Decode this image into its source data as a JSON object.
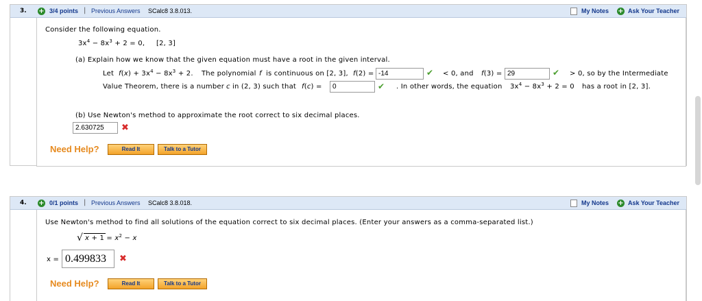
{
  "q3": {
    "number": "3.",
    "points": "3/4 points",
    "previous": "Previous Answers",
    "source": "SCalc8 3.8.013.",
    "my_notes": "My Notes",
    "ask_teacher": "Ask Your Teacher",
    "intro": "Consider the following equation.",
    "interval": "[2, 3]",
    "part_a": "(a) Explain how we know that the given equation must have a root in the given interval.",
    "line1_a": "Let",
    "line1_b": "The polynomial",
    "line1_c": "is continuous on [2, 3],",
    "f2_value": "-14",
    "line1_d": "< 0, and",
    "f3_value": "29",
    "line1_e": "> 0, so by the Intermediate",
    "line2_a": "Value Theorem, there is a number",
    "line2_b": "in (2, 3) such that",
    "fc_value": "0",
    "line2_c": ". In other words, the equation",
    "line2_d": "has a root in [2, 3].",
    "part_b": "(b) Use Newton's method to approximate the root correct to six decimal places.",
    "answer_b": "2.630725",
    "need_help": "Need Help?",
    "read_it": "Read It",
    "talk_tutor": "Talk to a Tutor"
  },
  "q4": {
    "number": "4.",
    "points": "0/1 points",
    "previous": "Previous Answers",
    "source": "SCalc8 3.8.018.",
    "my_notes": "My Notes",
    "ask_teacher": "Ask Your Teacher",
    "prompt": "Use Newton's method to find all solutions of the equation correct to six decimal places. (Enter your answers as a comma-separated list.)",
    "x_label": "x =",
    "answer": "0.499833",
    "need_help": "Need Help?",
    "read_it": "Read It",
    "talk_tutor": "Talk to a Tutor"
  },
  "colors": {
    "header_bg": "#dde8f6",
    "link": "#14388c",
    "help": "#e68a1f",
    "correct": "#4a9e2e",
    "wrong": "#d82c2c"
  },
  "icons": [
    "plus-circle-icon",
    "checkbox-icon",
    "check-icon",
    "cross-icon"
  ]
}
